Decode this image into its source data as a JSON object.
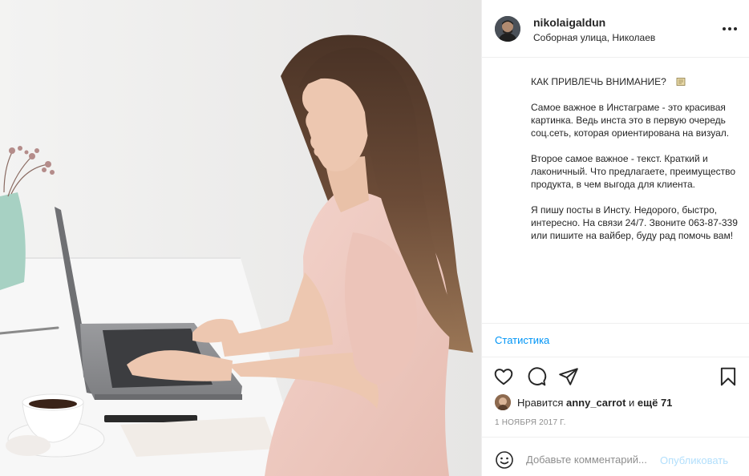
{
  "post": {
    "username": "nikolaigaldun",
    "location": "Соборная улица, Николаев",
    "more_icon": "more-horizontal-icon",
    "caption": {
      "title": "КАК ПРИВЛЕЧЬ ВНИМАНИЕ?",
      "title_icon": "scroll-emoji-icon",
      "paragraphs": [
        "Самое важное в Инстаграме - это красивая картинка. Ведь инста это в первую очередь соц.сеть, которая ориентирована на визуал.",
        "Второе самое важное - текст. Краткий и лаконичный. Что предлагаете, преимущество продукта, в чем выгода для клиента.",
        "Я пишу посты в Инсту. Недорого, быстро, интересно. На связи 24/7. Звоните 063-87-339 или пишите на вайбер, буду рад помочь вам!"
      ]
    },
    "stats_link": "Статистика",
    "likes": {
      "prefix": "Нравится ",
      "user": "anny_carrot",
      "middle": " и ",
      "others": "ещё 71"
    },
    "date": "1 НОЯБРЯ 2017 Г.",
    "comment": {
      "placeholder": "Добавьте комментарий...",
      "value": "",
      "publish_label": "Опубликовать"
    }
  },
  "colors": {
    "link": "#0095f6",
    "publish_disabled": "#b2dffc",
    "muted": "#8e8e8e",
    "text": "#262626",
    "border": "#efefef"
  }
}
